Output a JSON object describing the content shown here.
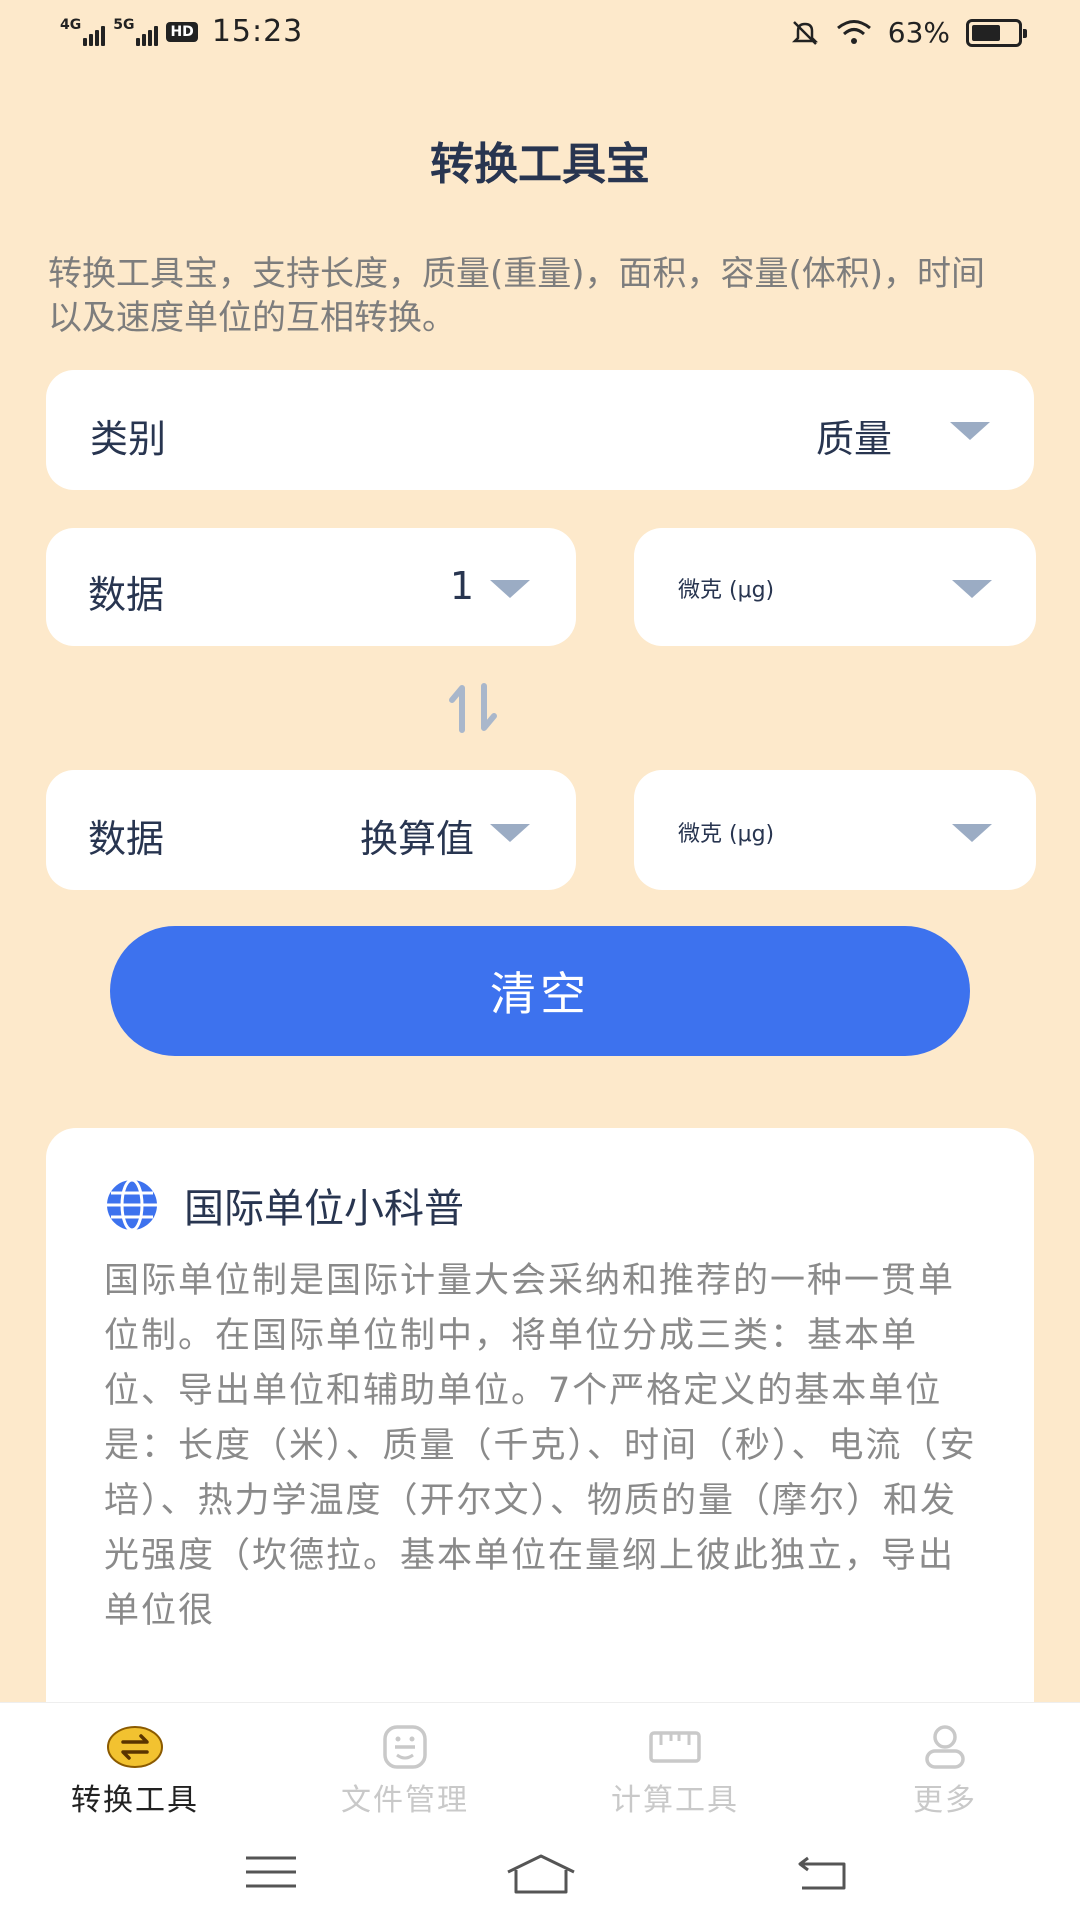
{
  "status_bar": {
    "net1": "4G",
    "net2": "5G",
    "hd": "HD",
    "time": "15:23",
    "battery": "63%",
    "battery_level": 0.63
  },
  "page": {
    "title": "转换工具宝",
    "description": "转换工具宝，支持长度，质量(重量)，面积，容量(体积)，时间以及速度单位的互相转换。"
  },
  "category": {
    "label": "类别",
    "value": "质量"
  },
  "input": {
    "label": "数据",
    "value": "1",
    "unit": "微克 (μg)"
  },
  "output": {
    "label": "数据",
    "value": "换算值",
    "unit": "微克 (μg)"
  },
  "swap_icon": "swap-arrows-icon",
  "clear_button": "清空",
  "info": {
    "title": "国际单位小科普",
    "body": "国际单位制是国际计量大会采纳和推荐的一种一贯单位制。在国际单位制中，将单位分成三类：基本单位、导出单位和辅助单位。7个严格定义的基本单位是：长度（米）、质量（千克）、时间（秒）、电流（安培）、热力学温度（开尔文）、物质的量（摩尔）和发光强度（坎德拉。基本单位在量纲上彼此独立，导出单位很"
  },
  "nav": [
    {
      "label": "转换工具",
      "icon": "convert-icon",
      "active": true
    },
    {
      "label": "文件管理",
      "icon": "scan-file-icon",
      "active": false
    },
    {
      "label": "计算工具",
      "icon": "ruler-icon",
      "active": false
    },
    {
      "label": "更多",
      "icon": "user-icon",
      "active": false
    }
  ],
  "colors": {
    "background": "#fde9cb",
    "accent": "#3d72ee",
    "active_icon": "#f2c230",
    "title": "#283550"
  }
}
